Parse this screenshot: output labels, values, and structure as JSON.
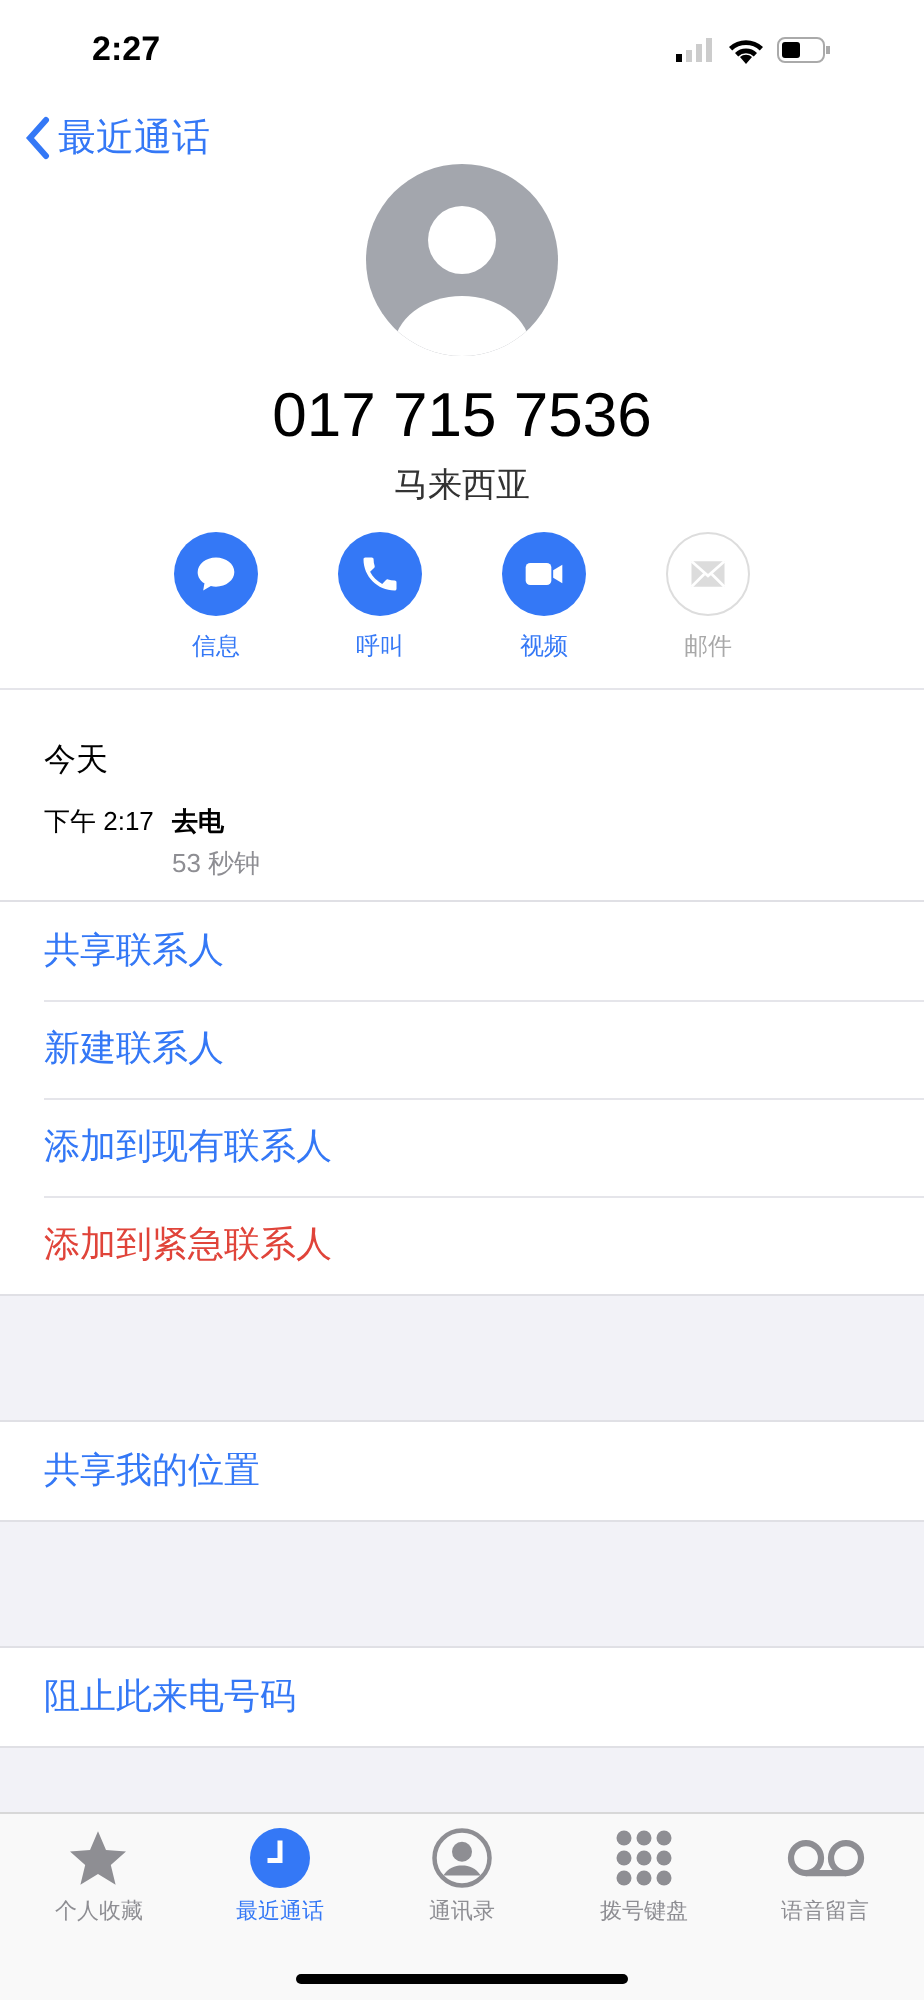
{
  "status_bar": {
    "time": "2:27"
  },
  "nav": {
    "back_label": "最近通话"
  },
  "contact": {
    "number": "017 715 7536",
    "location": "马来西亚"
  },
  "actions": [
    {
      "kind": "message",
      "label": "信息",
      "disabled": false
    },
    {
      "kind": "call",
      "label": "呼叫",
      "disabled": false
    },
    {
      "kind": "video",
      "label": "视频",
      "disabled": false
    },
    {
      "kind": "mail",
      "label": "邮件",
      "disabled": true
    }
  ],
  "call_log": {
    "date": "今天",
    "entries": [
      {
        "time": "下午 2:17",
        "type": "去电",
        "duration": "53 秒钟"
      }
    ]
  },
  "sections": [
    {
      "items": [
        {
          "label": "共享联系人",
          "destructive": false
        },
        {
          "label": "新建联系人",
          "destructive": false
        },
        {
          "label": "添加到现有联系人",
          "destructive": false
        },
        {
          "label": "添加到紧急联系人",
          "destructive": true
        }
      ]
    },
    {
      "items": [
        {
          "label": "共享我的位置",
          "destructive": false
        }
      ]
    },
    {
      "items": [
        {
          "label": "阻止此来电号码",
          "destructive": false
        }
      ]
    }
  ],
  "tab_bar": [
    {
      "kind": "favorites",
      "label": "个人收藏",
      "selected": false
    },
    {
      "kind": "recents",
      "label": "最近通话",
      "selected": true
    },
    {
      "kind": "contacts",
      "label": "通讯录",
      "selected": false
    },
    {
      "kind": "keypad",
      "label": "拨号键盘",
      "selected": false
    },
    {
      "kind": "voicemail",
      "label": "语音留言",
      "selected": false
    }
  ]
}
